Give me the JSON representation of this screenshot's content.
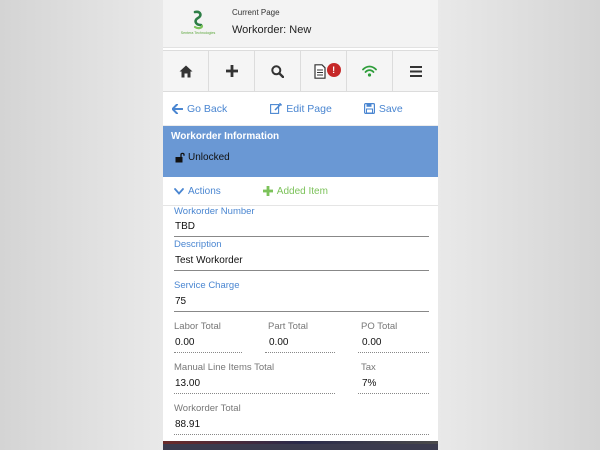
{
  "header": {
    "logo_text": "Sentera Technologies",
    "current_label": "Current Page",
    "current_title": "Workorder: New"
  },
  "toolbar": {
    "buttons": [
      "home-icon",
      "plus-icon",
      "search-icon",
      "document-icon",
      "wifi-icon",
      "menu-icon"
    ],
    "document_badge": "!"
  },
  "actions": {
    "go_back": "Go Back",
    "edit_page": "Edit Page",
    "save": "Save"
  },
  "section": {
    "title": "Workorder Information",
    "lock_status": "Unlocked",
    "actions_label": "Actions",
    "added_item_label": "Added Item"
  },
  "fields": {
    "workorder_number": {
      "label": "Workorder Number",
      "value": "TBD"
    },
    "description": {
      "label": "Description",
      "value": "Test Workorder"
    },
    "service_charge": {
      "label": "Service Charge",
      "value": "75"
    },
    "labor_total": {
      "label": "Labor Total",
      "value": "0.00"
    },
    "part_total": {
      "label": "Part Total",
      "value": "0.00"
    },
    "po_total": {
      "label": "PO Total",
      "value": "0.00"
    },
    "manual_line_items_total": {
      "label": "Manual Line Items Total",
      "value": "13.00"
    },
    "tax": {
      "label": "Tax",
      "value": "7%"
    },
    "workorder_total": {
      "label": "Workorder Total",
      "value": "88.91"
    }
  },
  "colors": {
    "accent_blue": "#4a86d1",
    "banner_blue": "#6a98d4",
    "added_green": "#7cc25a",
    "badge_red": "#c62828",
    "wifi_green": "#2e9d3a"
  }
}
